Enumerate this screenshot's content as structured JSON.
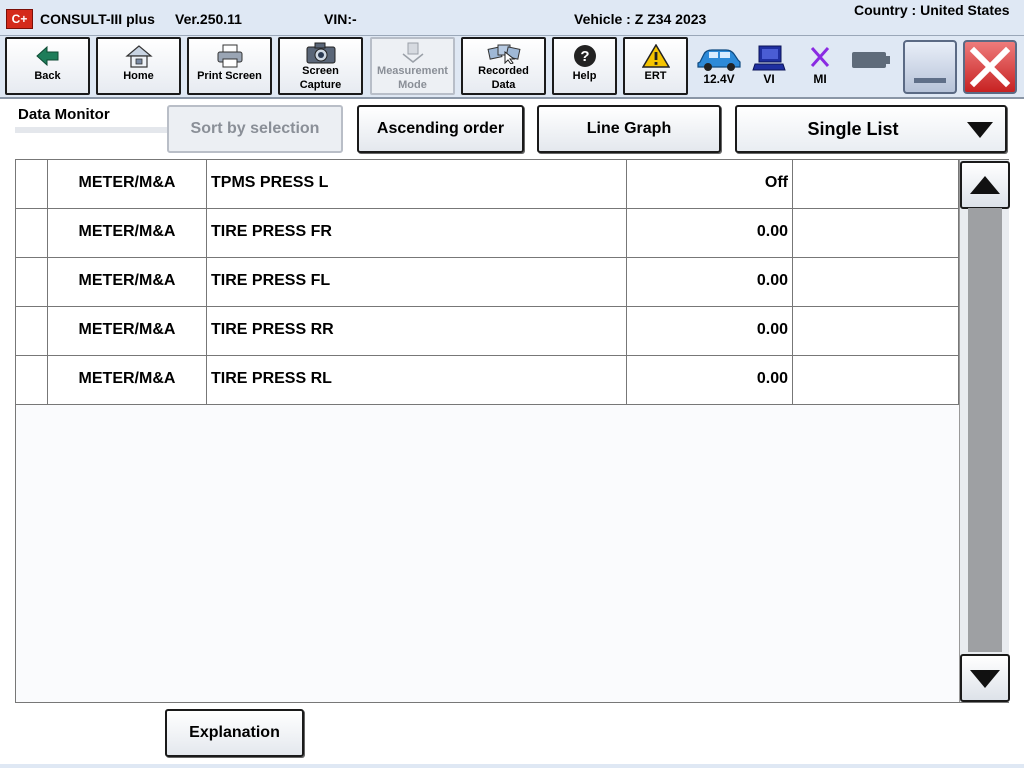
{
  "titlebar": {
    "logo": "C+",
    "app_name": "CONSULT-III plus",
    "version": "Ver.250.11",
    "vin": "VIN:-",
    "vehicle": "Vehicle : Z Z34 2023",
    "country": "Country : United States"
  },
  "toolbar": {
    "back": "Back",
    "home": "Home",
    "print_screen": "Print Screen",
    "screen_capture_1": "Screen",
    "screen_capture_2": "Capture",
    "measurement_mode_1": "Measurement",
    "measurement_mode_2": "Mode",
    "recorded_data_1": "Recorded",
    "recorded_data_2": "Data",
    "help": "Help",
    "ert": "ERT",
    "battery_voltage": "12.4V",
    "vi": "VI",
    "mi": "MI"
  },
  "data_monitor": {
    "title": "Data Monitor",
    "sort_by_selection": "Sort by selection",
    "ascending_order": "Ascending order",
    "line_graph": "Line Graph",
    "view_mode": "Single List"
  },
  "rows": [
    {
      "system": "METER/M&A",
      "item": "TPMS PRESS L",
      "value": "Off",
      "unit": ""
    },
    {
      "system": "METER/M&A",
      "item": "TIRE PRESS FR",
      "value": "0.00",
      "unit": ""
    },
    {
      "system": "METER/M&A",
      "item": "TIRE PRESS FL",
      "value": "0.00",
      "unit": ""
    },
    {
      "system": "METER/M&A",
      "item": "TIRE PRESS RR",
      "value": "0.00",
      "unit": ""
    },
    {
      "system": "METER/M&A",
      "item": "TIRE PRESS RL",
      "value": "0.00",
      "unit": ""
    }
  ],
  "footer": {
    "explanation": "Explanation"
  },
  "colors": {
    "chrome_bg": "#dfe8f4",
    "close_red": "#c72222",
    "logo_red": "#d42a1b",
    "mi_purple": "#8a2be2"
  }
}
